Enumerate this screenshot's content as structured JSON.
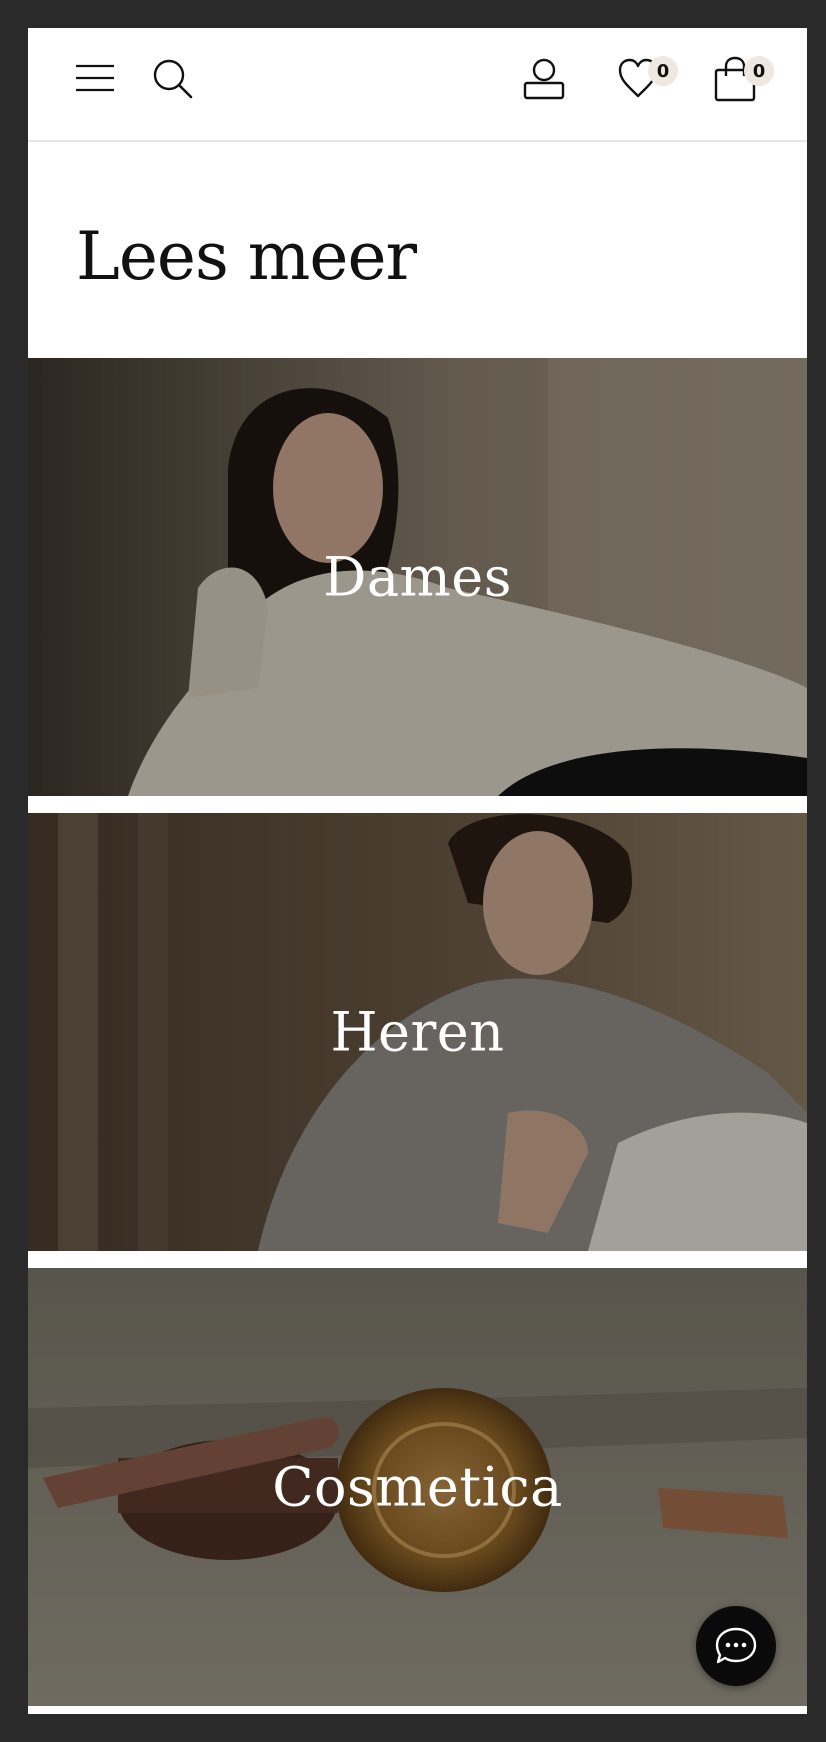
{
  "header": {
    "menu_icon": "hamburger-menu-icon",
    "search_icon": "search-icon",
    "account_icon": "user-icon",
    "wishlist_icon": "heart-icon",
    "wishlist_count": "0",
    "cart_icon": "shopping-bag-icon",
    "cart_count": "0"
  },
  "page": {
    "title": "Lees meer"
  },
  "categories": [
    {
      "label": "Dames"
    },
    {
      "label": "Heren"
    },
    {
      "label": "Cosmetica"
    }
  ],
  "chat": {
    "icon": "chat-bubble-icon"
  },
  "colors": {
    "frame": "#2a2a2a",
    "badge": "#efe8e0",
    "text": "#111111"
  }
}
